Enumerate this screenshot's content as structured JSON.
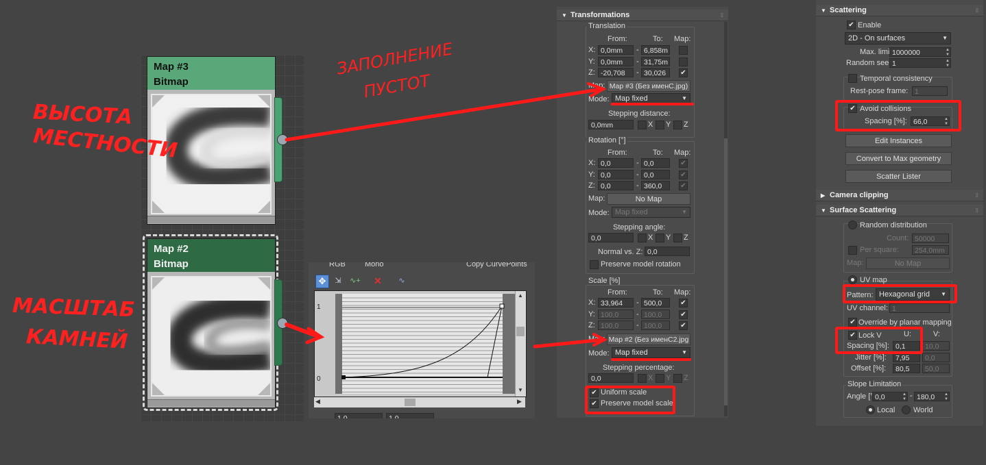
{
  "nodes": [
    {
      "title": "Map #3",
      "subtitle": "Bitmap",
      "header_color": "#5aa87a"
    },
    {
      "title": "Map #2",
      "subtitle": "Bitmap",
      "header_color": "#2e6b45"
    }
  ],
  "annotations": {
    "fill_gaps_l1": "ЗАПОЛНЕНИЕ",
    "fill_gaps_l2": "ПУСТОТ",
    "terrain_l1": "ВЫСОТА",
    "terrain_l2": "МЕСТНОСТИ",
    "scale_l1": "МАСШТАБ",
    "scale_l2": "КАМНЕЙ",
    "color": "#ff1a1a"
  },
  "curve_editor": {
    "top_labels": [
      "RGB",
      "Mono",
      "Copy CurvePoints"
    ],
    "y_top": "1",
    "y_bottom": "0",
    "bottom_fields": [
      "1,0",
      "1,0"
    ]
  },
  "transformations": {
    "title": "Transformations",
    "translation": {
      "title": "Translation",
      "hdr_from": "From:",
      "hdr_to": "To:",
      "hdr_map": "Map:",
      "rows": [
        {
          "axis": "X:",
          "from": "0,0mm",
          "to": "6,858m",
          "checked": false
        },
        {
          "axis": "Y:",
          "from": "0,0mm",
          "to": "31,75m",
          "checked": false
        },
        {
          "axis": "Z:",
          "from": "-20,708",
          "to": "30,026",
          "checked": true
        }
      ],
      "map_label": "Map:",
      "map_value": "Map #3 (Без именС.jpg)",
      "mode_label": "Mode:",
      "mode_value": "Map fixed",
      "step_label": "Stepping distance:",
      "step_value": "0,0mm"
    },
    "rotation": {
      "title": "Rotation [°]",
      "hdr_from": "From:",
      "hdr_to": "To:",
      "hdr_map": "Map:",
      "rows": [
        {
          "axis": "X:",
          "from": "0,0",
          "to": "0,0"
        },
        {
          "axis": "Y:",
          "from": "0,0",
          "to": "0,0"
        },
        {
          "axis": "Z:",
          "from": "0,0",
          "to": "360,0"
        }
      ],
      "map_label": "Map:",
      "map_value": "No Map",
      "mode_label": "Mode:",
      "mode_value": "Map fixed",
      "step_label": "Stepping angle:",
      "step_value": "0,0",
      "normal_label": "Normal vs. Z:",
      "normal_value": "0,0",
      "preserve_label": "Preserve model rotation"
    },
    "scale": {
      "title": "Scale [%]",
      "hdr_from": "From:",
      "hdr_to": "To:",
      "hdr_map": "Map:",
      "rows": [
        {
          "axis": "X:",
          "from": "33,964",
          "to": "500,0"
        },
        {
          "axis": "Y:",
          "from": "100,0",
          "to": "100,0"
        },
        {
          "axis": "Z:",
          "from": "100,0",
          "to": "100,0"
        }
      ],
      "map_label": "Map:",
      "map_value": "Map #2 (Без именС2.jpg",
      "mode_label": "Mode:",
      "mode_value": "Map fixed",
      "step_label": "Stepping percentage:",
      "step_value": "0,0",
      "uniform_label": "Uniform scale",
      "preserve_label": "Preserve model scale"
    },
    "xyz": [
      "X",
      "Y",
      "Z"
    ]
  },
  "scattering": {
    "title": "Scattering",
    "enable_label": "Enable",
    "mode_value": "2D - On surfaces",
    "max_limit_label": "Max. limit:",
    "max_limit_value": "1000000",
    "seed_label": "Random seed:",
    "seed_value": "1",
    "temporal_label": "Temporal consistency",
    "rest_pose_label": "Rest-pose frame:",
    "rest_pose_value": "1",
    "avoid_label": "Avoid collisions",
    "spacing_label": "Spacing [%]:",
    "spacing_value": "66,0",
    "btn_edit": "Edit Instances",
    "btn_convert": "Convert to Max geometry",
    "btn_lister": "Scatter Lister"
  },
  "camera_clipping": {
    "title": "Camera clipping"
  },
  "surface_scattering": {
    "title": "Surface Scattering",
    "random_label": "Random distribution",
    "count_label": "Count:",
    "count_value": "50000",
    "per_square_label": "Per square:",
    "per_square_value": "254,0mm",
    "map_label": "Map:",
    "map_value": "No Map",
    "uv_label": "UV map",
    "pattern_label": "Pattern:",
    "pattern_value": "Hexagonal grid",
    "uv_channel_label": "UV channel:",
    "uv_channel_value": "1",
    "override_label": "Override by planar mapping",
    "lock_label": "Lock V",
    "u_hdr": "U:",
    "v_hdr": "V:",
    "spacing_label": "Spacing [%]:",
    "spacing_u": "0,1",
    "spacing_v": "10,0",
    "jitter_label": "Jitter [%]:",
    "jitter_u": "7,95",
    "jitter_v": "0,0",
    "offset_label": "Offset [%]:",
    "offset_u": "80,5",
    "offset_v": "50,0",
    "slope_title": "Slope Limitation",
    "angle_label": "Angle [°]:",
    "angle_from": "0,0",
    "angle_to": "180,0",
    "local_label": "Local",
    "world_label": "World"
  }
}
